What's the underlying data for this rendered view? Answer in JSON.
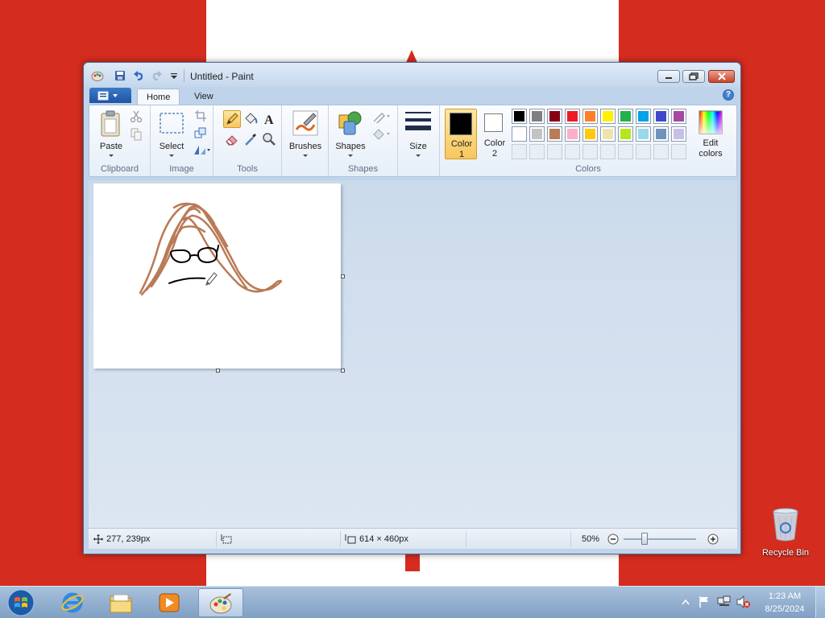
{
  "window": {
    "title": "Untitled - Paint"
  },
  "tabs": {
    "home": "Home",
    "view": "View"
  },
  "ribbon": {
    "clipboard": {
      "paste_label": "Paste",
      "group_label": "Clipboard"
    },
    "image": {
      "select_label": "Select",
      "group_label": "Image"
    },
    "tools": {
      "group_label": "Tools"
    },
    "brushes": {
      "label": "Brushes"
    },
    "shapes": {
      "label": "Shapes",
      "group_label": "Shapes"
    },
    "size": {
      "label": "Size"
    },
    "colors": {
      "color1_label": "Color",
      "color1_num": "1",
      "color2_label": "Color",
      "color2_num": "2",
      "edit_label": "Edit",
      "edit_label2": "colors",
      "group_label": "Colors",
      "color1_value": "#000000",
      "color2_value": "#ffffff",
      "palette_row1": [
        "#000000",
        "#7f7f7f",
        "#880015",
        "#ed1c24",
        "#ff7f27",
        "#fff200",
        "#22b14c",
        "#00a2e8",
        "#3f48cc",
        "#a349a4"
      ],
      "palette_row2": [
        "#ffffff",
        "#c3c3c3",
        "#b97a57",
        "#ffaec9",
        "#ffc90e",
        "#efe4b0",
        "#b5e61d",
        "#99d9ea",
        "#7092be",
        "#c8bfe7"
      ]
    }
  },
  "status": {
    "cursor_pos": "277, 239px",
    "canvas_size": "614 × 460px",
    "zoom": "50%"
  },
  "desktop": {
    "recycle_bin": "Recycle Bin"
  },
  "taskbar": {
    "time": "1:23 AM",
    "date": "8/25/2024"
  }
}
